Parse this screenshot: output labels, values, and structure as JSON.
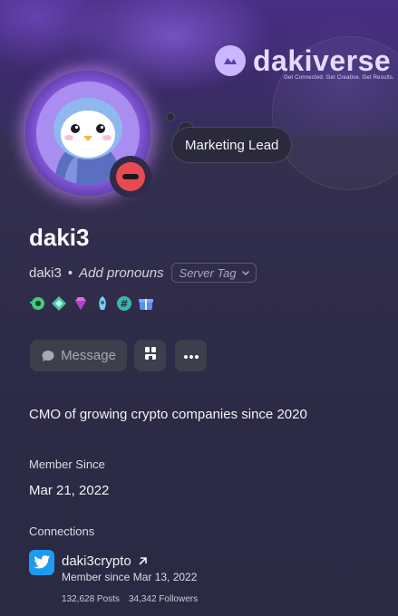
{
  "banner": {
    "brand_name": "dakiverse",
    "brand_tagline": "Get Connected. Get Creative. Get Results."
  },
  "profile": {
    "status_text": "Marketing Lead",
    "display_name": "daki3",
    "username": "daki3",
    "separator": "•",
    "pronouns_placeholder": "Add pronouns",
    "server_tag_label": "Server Tag",
    "status": "do-not-disturb",
    "badges": [
      "nitro-badge",
      "hypesquad-badge",
      "gem-badge",
      "boost-badge",
      "quest-badge",
      "gift-badge"
    ]
  },
  "actions": {
    "message_label": "Message"
  },
  "bio": "CMO of growing crypto companies since 2020",
  "member_since": {
    "title": "Member Since",
    "value": "Mar 21, 2022"
  },
  "connections": {
    "title": "Connections",
    "items": [
      {
        "platform": "twitter",
        "name": "daki3crypto",
        "since": "Member since Mar 13, 2022",
        "posts": "132,628 Posts",
        "followers": "34,342 Followers"
      }
    ]
  },
  "colors": {
    "background": "#2c2a45",
    "banner": "#4a2f86",
    "dnd_red": "#e84a52",
    "twitter_blue": "#1d9bf0",
    "button_bg": "#3e3f4c"
  }
}
